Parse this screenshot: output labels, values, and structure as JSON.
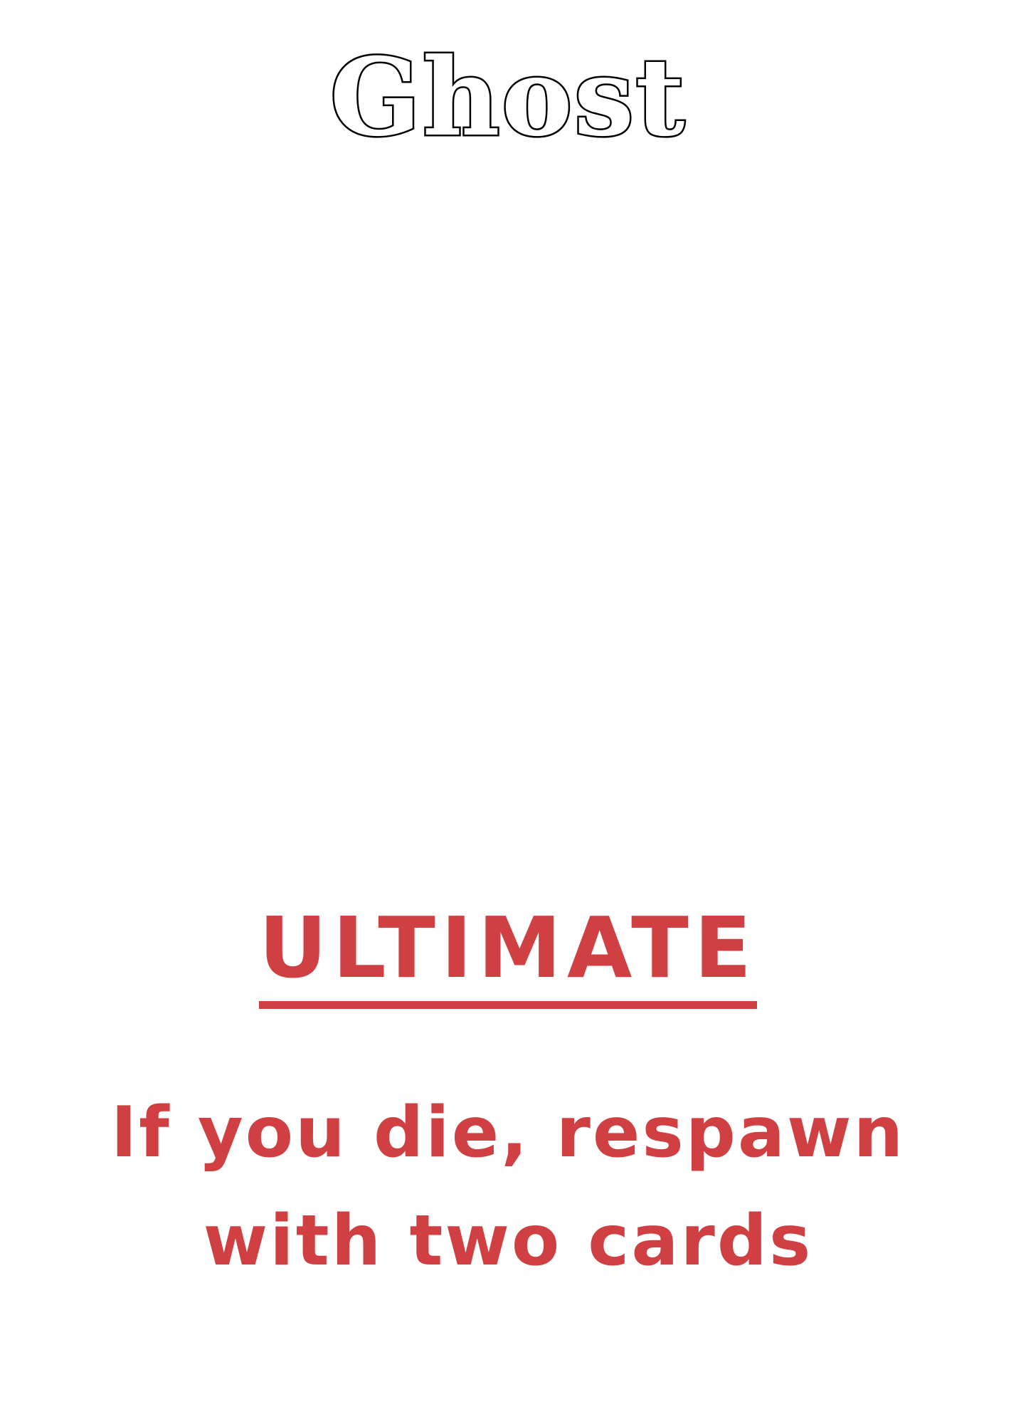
{
  "card": {
    "title": "Ghost",
    "section_heading": "ULTIMATE",
    "ability_text": "If you die, respawn with two cards"
  },
  "colors": {
    "title_outline": "#000000",
    "accent": "#d04043",
    "background": "#ffffff"
  }
}
